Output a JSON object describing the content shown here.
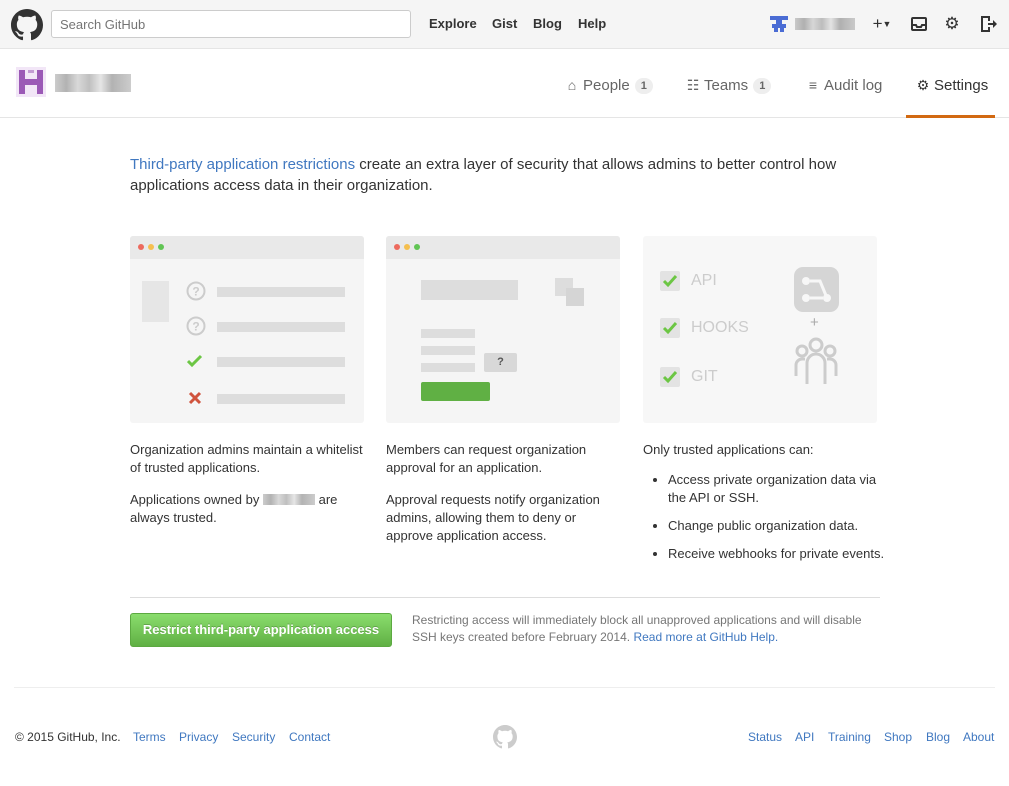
{
  "header": {
    "search_placeholder": "Search GitHub",
    "nav": [
      "Explore",
      "Gist",
      "Blog",
      "Help"
    ]
  },
  "org_nav": {
    "tabs": [
      {
        "label": "People",
        "count": "1"
      },
      {
        "label": "Teams",
        "count": "1"
      },
      {
        "label": "Audit log"
      },
      {
        "label": "Settings"
      }
    ]
  },
  "intro": {
    "link": "Third-party application restrictions",
    "text": " create an extra layer of security that allows admins to better control how applications access data in their organization."
  },
  "illustrations": {
    "card3_items": [
      "API",
      "HOOKS",
      "GIT"
    ],
    "card3_plus": "+",
    "card2_question": "?"
  },
  "columns": {
    "col1_p1": "Organization admins maintain a whitelist of trusted applications.",
    "col1_p2_before": "Applications owned by",
    "col1_p2_after": "are always trusted.",
    "col2_p1": "Members can request organization approval for an application.",
    "col2_p2": "Approval requests notify organization admins, allowing them to deny or approve application access.",
    "col3_intro": "Only trusted applications can:",
    "col3_items": [
      "Access private organization data via the API or SSH.",
      "Change public organization data.",
      "Receive webhooks for private events."
    ]
  },
  "action": {
    "button_label": "Restrict third-party application access",
    "note": "Restricting access will immediately block all unapproved applications and will disable SSH keys created before February 2014.",
    "note_link": "Read more at GitHub Help."
  },
  "footer": {
    "copyright": "© 2015 GitHub, Inc.",
    "left_links": [
      "Terms",
      "Privacy",
      "Security",
      "Contact"
    ],
    "right_links": [
      "Status",
      "API",
      "Training",
      "Shop",
      "Blog",
      "About"
    ]
  },
  "colors": {
    "link": "#4078c0",
    "accent_tab": "#d26911",
    "button_green": "#60b044",
    "check_green": "#6cc644",
    "cross_red": "#bd2c00"
  }
}
